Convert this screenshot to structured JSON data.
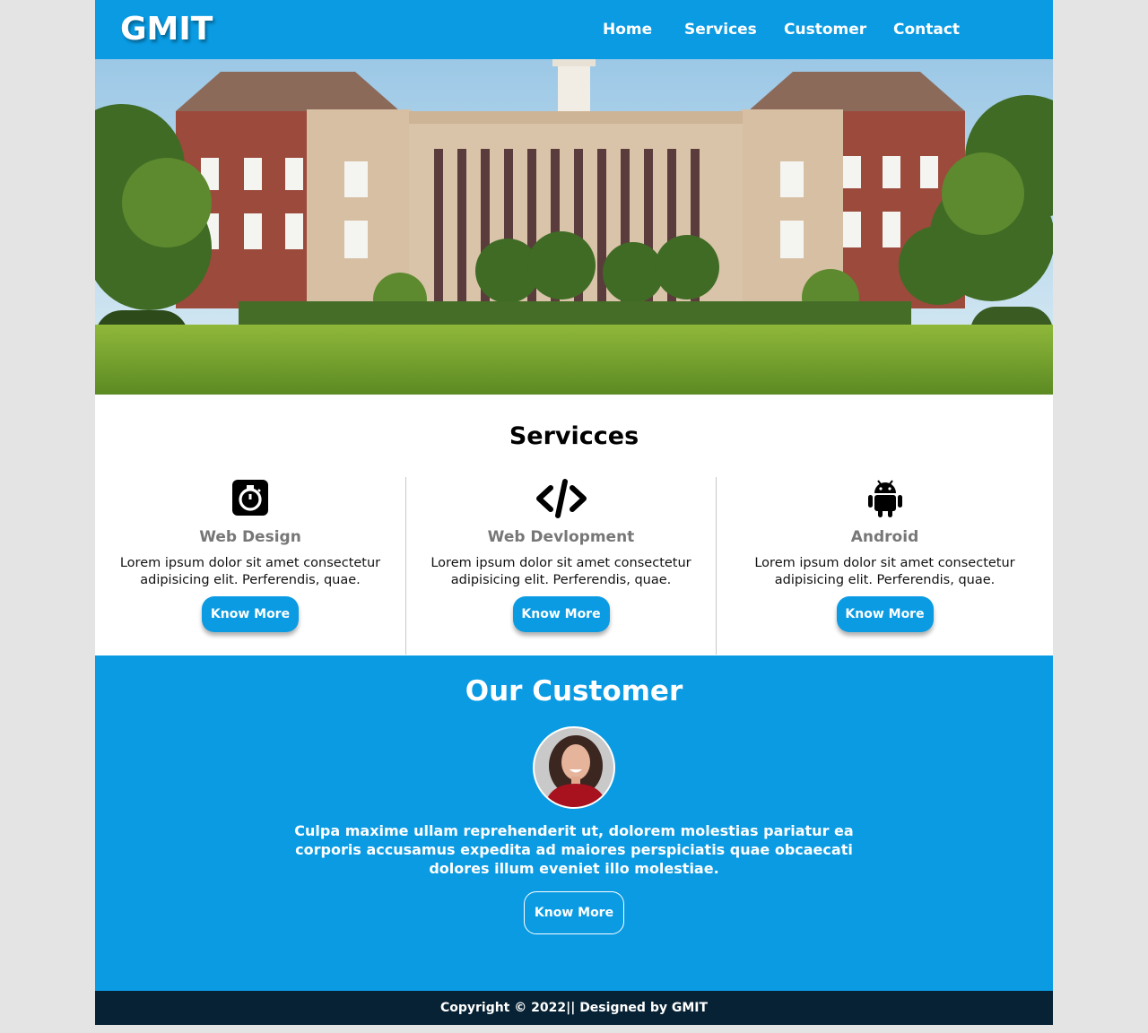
{
  "header": {
    "logo": "GMIT",
    "nav": [
      {
        "label": "Home"
      },
      {
        "label": "Services"
      },
      {
        "label": "Customer"
      },
      {
        "label": "Contact"
      }
    ]
  },
  "hero": {
    "image": "university-building-photo"
  },
  "services": {
    "title": "Servicces",
    "items": [
      {
        "icon": "stopwatch-icon",
        "title": "Web Design",
        "text": "Lorem ipsum dolor sit amet consectetur adipisicing elit. Perferendis, quae.",
        "button": "Know More"
      },
      {
        "icon": "code-icon",
        "title": "Web Devlopment",
        "text": "Lorem ipsum dolor sit amet consectetur adipisicing elit. Perferendis, quae.",
        "button": "Know More"
      },
      {
        "icon": "android-icon",
        "title": "Android",
        "text": "Lorem ipsum dolor sit amet consectetur adipisicing elit. Perferendis, quae.",
        "button": "Know More"
      }
    ]
  },
  "customer": {
    "title": "Our Customer",
    "quote": "Culpa maxime ullam reprehenderit ut, dolorem molestias pariatur ea corporis accusamus expedita ad maiores perspiciatis quae obcaecati dolores illum eveniet illo molestiae.",
    "button": "Know More"
  },
  "footer": {
    "text": "Copyright © 2022|| Designed by GMIT"
  },
  "colors": {
    "accent": "#0a9be3",
    "footer": "#072234"
  }
}
